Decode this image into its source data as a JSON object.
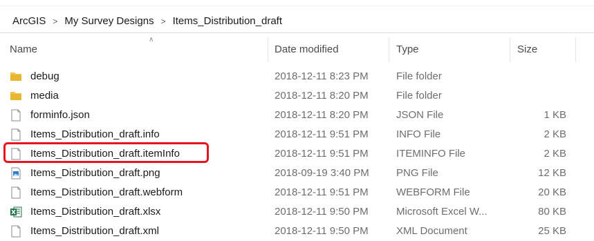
{
  "breadcrumb": [
    "ArcGIS",
    "My Survey Designs",
    "Items_Distribution_draft"
  ],
  "breadcrumb_separator": ">",
  "columns": {
    "name": "Name",
    "date": "Date modified",
    "type": "Type",
    "size": "Size"
  },
  "files": [
    {
      "name": "debug",
      "date": "2018-12-11 8:23 PM",
      "type": "File folder",
      "size": "",
      "icon": "folder-icon"
    },
    {
      "name": "media",
      "date": "2018-12-11 8:20 PM",
      "type": "File folder",
      "size": "",
      "icon": "folder-icon"
    },
    {
      "name": "forminfo.json",
      "date": "2018-12-11 8:20 PM",
      "type": "JSON File",
      "size": "1 KB",
      "icon": "file-icon"
    },
    {
      "name": "Items_Distribution_draft.info",
      "date": "2018-12-11 9:51 PM",
      "type": "INFO File",
      "size": "2 KB",
      "icon": "file-icon"
    },
    {
      "name": "Items_Distribution_draft.itemInfo",
      "date": "2018-12-11 9:51 PM",
      "type": "ITEMINFO File",
      "size": "2 KB",
      "icon": "file-icon"
    },
    {
      "name": "Items_Distribution_draft.png",
      "date": "2018-09-19 3:40 PM",
      "type": "PNG File",
      "size": "12 KB",
      "icon": "image-file-icon"
    },
    {
      "name": "Items_Distribution_draft.webform",
      "date": "2018-12-11 9:51 PM",
      "type": "WEBFORM File",
      "size": "20 KB",
      "icon": "file-icon"
    },
    {
      "name": "Items_Distribution_draft.xlsx",
      "date": "2018-12-11 9:50 PM",
      "type": "Microsoft Excel W...",
      "size": "80 KB",
      "icon": "excel-file-icon"
    },
    {
      "name": "Items_Distribution_draft.xml",
      "date": "2018-12-11 9:50 PM",
      "type": "XML Document",
      "size": "25 KB",
      "icon": "file-icon"
    }
  ],
  "highlighted_file": "Items_Distribution_draft.itemInfo",
  "colors": {
    "highlight": "#e8141c",
    "folder": "#f4c542",
    "excel": "#1e7145",
    "image": "#2b7bd1"
  }
}
